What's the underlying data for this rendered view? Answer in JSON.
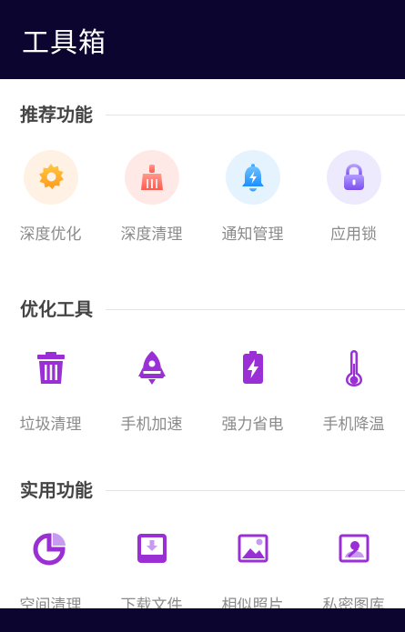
{
  "header": {
    "title": "工具箱"
  },
  "sections": [
    {
      "title": "推荐功能",
      "items": [
        {
          "label": "深度优化",
          "icon": "gear-icon",
          "bg": "#fff1e3",
          "color": "#ffb01f"
        },
        {
          "label": "深度清理",
          "icon": "broom-icon",
          "bg": "#ffe9e7",
          "color": "#ff6a5e"
        },
        {
          "label": "通知管理",
          "icon": "bell-icon",
          "bg": "#e5f3ff",
          "color": "#2fa0ff"
        },
        {
          "label": "应用锁",
          "icon": "lock-icon",
          "bg": "#eeeafe",
          "color": "#8f6bf5"
        }
      ]
    },
    {
      "title": "优化工具",
      "items": [
        {
          "label": "垃圾清理",
          "icon": "trash-icon",
          "color": "#9b2fd6"
        },
        {
          "label": "手机加速",
          "icon": "rocket-icon",
          "color": "#9b2fd6"
        },
        {
          "label": "强力省电",
          "icon": "battery-icon",
          "color": "#9b2fd6"
        },
        {
          "label": "手机降温",
          "icon": "thermometer-icon",
          "color": "#9b2fd6"
        }
      ]
    },
    {
      "title": "实用功能",
      "items": [
        {
          "label": "空间清理",
          "icon": "pie-chart-icon",
          "color": "#9b2fd6"
        },
        {
          "label": "下载文件",
          "icon": "download-icon",
          "color": "#9b2fd6"
        },
        {
          "label": "相似照片",
          "icon": "image-icon",
          "color": "#9b2fd6"
        },
        {
          "label": "私密图库",
          "icon": "private-gallery-icon",
          "color": "#9b2fd6"
        }
      ]
    }
  ]
}
